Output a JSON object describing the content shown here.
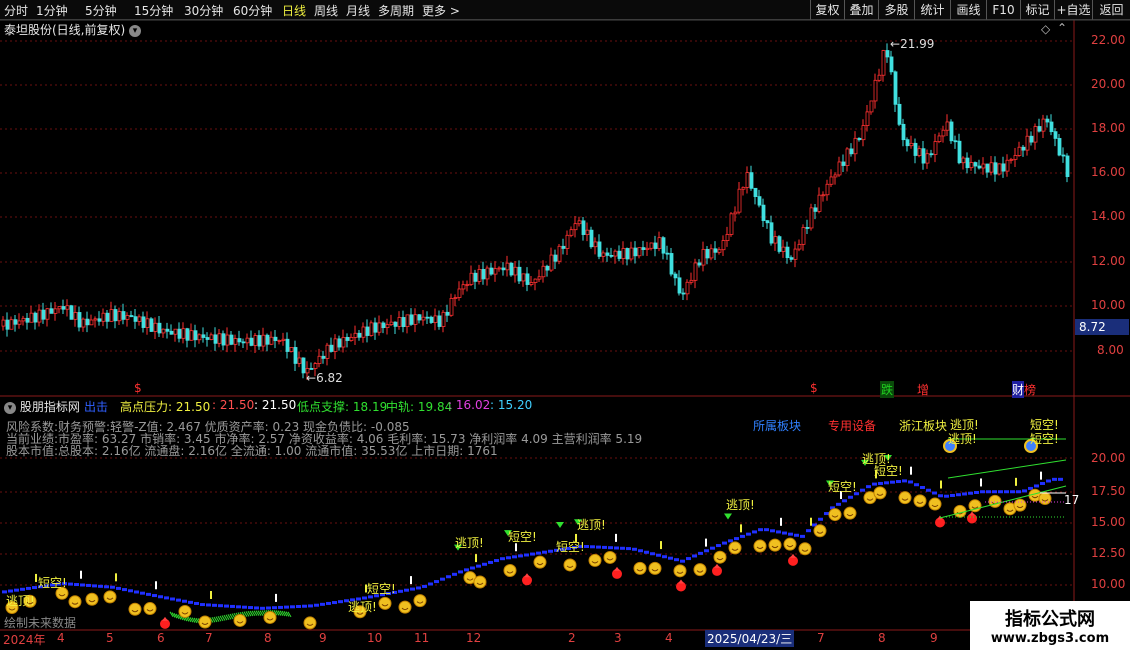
{
  "toolbar": {
    "periods": [
      "分时",
      "1分钟",
      "5分钟",
      "15分钟",
      "30分钟",
      "60分钟",
      "日线",
      "周线",
      "月线",
      "多周期",
      "更多"
    ],
    "more_arrow": ">",
    "buttons": [
      "复权",
      "叠加",
      "多股",
      "统计",
      "画线",
      "F10",
      "标记",
      "+自选",
      "返回"
    ]
  },
  "main_chart": {
    "title": "泰坦股份(日线,前复权)",
    "price_ticks": [
      "22.00",
      "20.00",
      "18.00",
      "16.00",
      "14.00",
      "12.00",
      "10.00",
      "8.00"
    ],
    "current_price": "8.72",
    "high_label": "21.99",
    "low_label": "6.82",
    "event_marks": [
      {
        "text": "$",
        "color": "#ff3030"
      },
      {
        "text": "$",
        "color": "#ff3030"
      },
      {
        "text": "跌",
        "color": "#20d020",
        "bg": "#0a4a0a"
      },
      {
        "text": "增",
        "color": "#ff3030"
      },
      {
        "text": "财",
        "color": "#ffffff",
        "bg": "#2020a0"
      },
      {
        "text": "榜",
        "color": "#ff3030"
      }
    ]
  },
  "indicator": {
    "name": "股朋指标网",
    "legend": [
      {
        "text": "出击",
        "color": "#3060ff"
      },
      {
        "text": "高点压力: 21.50",
        "color": "#f0f040"
      },
      {
        "text": ": 21.50",
        "color": "#ff5050"
      },
      {
        "text": ": 21.50",
        "color": "#ffffff"
      },
      {
        "text": "低点支撑: 18.19",
        "color": "#30e030"
      },
      {
        "text": "中轨: 19.84",
        "color": "#30e030"
      },
      {
        "text": ": 16.02",
        "color": "#e040e0"
      },
      {
        "text": ": 15.20",
        "color": "#40d0ff"
      }
    ],
    "info_lines": [
      "风险系数:财务预警:轻警-Z值: 2.467 优质资产率: 0.23 现金负债比: -0.085",
      "当前业绩:市盈率: 63.27 市销率: 3.45 市净率: 2.57 净资收益率: 4.06 毛利率: 15.73 净利润率 4.09 主营利润率 5.19",
      "股本市值:总股本: 2.16亿 流通盘: 2.16亿 全流通: 1.00 流通市值: 35.53亿 上市日期: 1761"
    ],
    "sector_labels": [
      {
        "text": "所属板块",
        "color": "#3080ff"
      },
      {
        "text": "专用设备",
        "color": "#ff3030"
      },
      {
        "text": "浙江板块",
        "color": "#f0f040"
      }
    ],
    "future_label": "绘制未来数据",
    "y_ticks": [
      "20.00",
      "17.50",
      "15.00",
      "12.50",
      "10.00"
    ],
    "right_val": "17"
  },
  "signal_labels": {
    "top": "逃顶!",
    "short": "短空!"
  },
  "x_axis": {
    "labels": [
      "2024年",
      "4",
      "5",
      "6",
      "7",
      "8",
      "9",
      "10",
      "11",
      "12",
      "2",
      "3",
      "4",
      "7",
      "8",
      "9"
    ],
    "highlight": "2025/04/23/三"
  },
  "watermark": {
    "line1": "指标公式网",
    "line2": "www.zbgs3.com"
  },
  "colors": {
    "up": "#ff3030",
    "down": "#40e0e0",
    "grid": "#6a1010",
    "axis_text": "#e04040"
  }
}
